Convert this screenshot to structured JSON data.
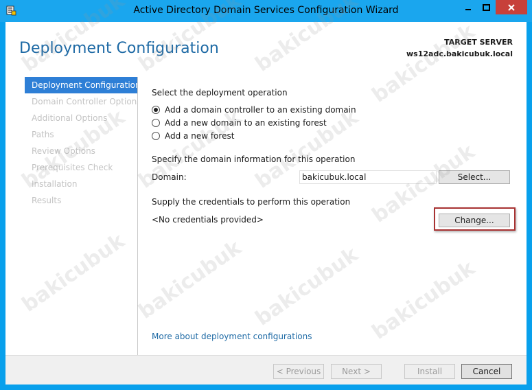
{
  "window": {
    "title": "Active Directory Domain Services Configuration Wizard"
  },
  "header": {
    "page_title": "Deployment Configuration",
    "target_server_label": "TARGET SERVER",
    "target_server_name": "ws12adc.bakicubuk.local"
  },
  "nav": {
    "items": [
      {
        "label": "Deployment Configuration",
        "active": true
      },
      {
        "label": "Domain Controller Options",
        "active": false
      },
      {
        "label": "Additional Options",
        "active": false
      },
      {
        "label": "Paths",
        "active": false
      },
      {
        "label": "Review Options",
        "active": false
      },
      {
        "label": "Prerequisites Check",
        "active": false
      },
      {
        "label": "Installation",
        "active": false
      },
      {
        "label": "Results",
        "active": false
      }
    ]
  },
  "main": {
    "operation_heading": "Select the deployment operation",
    "options": [
      {
        "label": "Add a domain controller to an existing domain",
        "checked": true
      },
      {
        "label": "Add a new domain to an existing forest",
        "checked": false
      },
      {
        "label": "Add a new forest",
        "checked": false
      }
    ],
    "domain_info_heading": "Specify the domain information for this operation",
    "domain_label": "Domain:",
    "domain_value": "bakicubuk.local",
    "select_button": "Select...",
    "credentials_heading": "Supply the credentials to perform this operation",
    "credentials_status": "<No credentials provided>",
    "change_button": "Change...",
    "more_link": "More about deployment configurations"
  },
  "footer": {
    "previous": "< Previous",
    "next": "Next >",
    "install": "Install",
    "cancel": "Cancel"
  },
  "watermark": "bakicubuk",
  "colors": {
    "title_bar": "#1aa6ee",
    "accent_blue": "#1e6aa5",
    "nav_active": "#2e7fd6",
    "close_button": "#c7403a",
    "highlight_border": "#a83232"
  }
}
